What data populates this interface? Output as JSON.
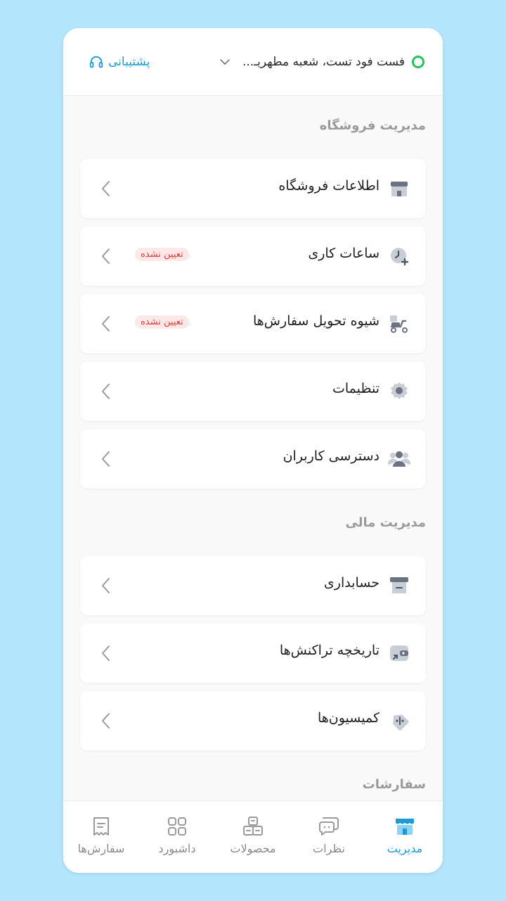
{
  "header": {
    "store_name": "فست فود تست، شعبه مطهریـ...",
    "support_label": "پشتیبانی"
  },
  "sections": {
    "store_management": "مدیریت فروشگاه",
    "financial_management": "مدیریت مالی",
    "orders": "سفارشات"
  },
  "store_items": [
    {
      "label": "اطلاعات فروشگاه",
      "icon": "store-icon"
    },
    {
      "label": "ساعات کاری",
      "icon": "clock-icon",
      "badge": "تعیین نشده"
    },
    {
      "label": "شیوه تحویل سفارش‌ها",
      "icon": "delivery-scooter-icon",
      "badge": "تعیین نشده"
    },
    {
      "label": "تنظیمات",
      "icon": "gear-icon"
    },
    {
      "label": "دسترسی کاربران",
      "icon": "users-icon"
    }
  ],
  "finance_items": [
    {
      "label": "حسابداری",
      "icon": "cash-register-icon"
    },
    {
      "label": "تاریخچه تراکنش‌ها",
      "icon": "wallet-icon"
    },
    {
      "label": "کمیسیون‌ها",
      "icon": "tag-icon"
    }
  ],
  "bottom_nav": [
    {
      "label": "سفارش‌ها",
      "icon": "receipt-icon"
    },
    {
      "label": "داشبورد",
      "icon": "dashboard-grid-icon"
    },
    {
      "label": "محصولات",
      "icon": "boxes-icon"
    },
    {
      "label": "نظرات",
      "icon": "chat-icon"
    },
    {
      "label": "مدیریت",
      "icon": "store-icon",
      "active": true
    }
  ],
  "colors": {
    "accent": "#1a9bd7",
    "status_online": "#22c55e",
    "badge_text": "#e53935",
    "badge_bg": "#fde8e8",
    "background": "#b3e5fc"
  }
}
